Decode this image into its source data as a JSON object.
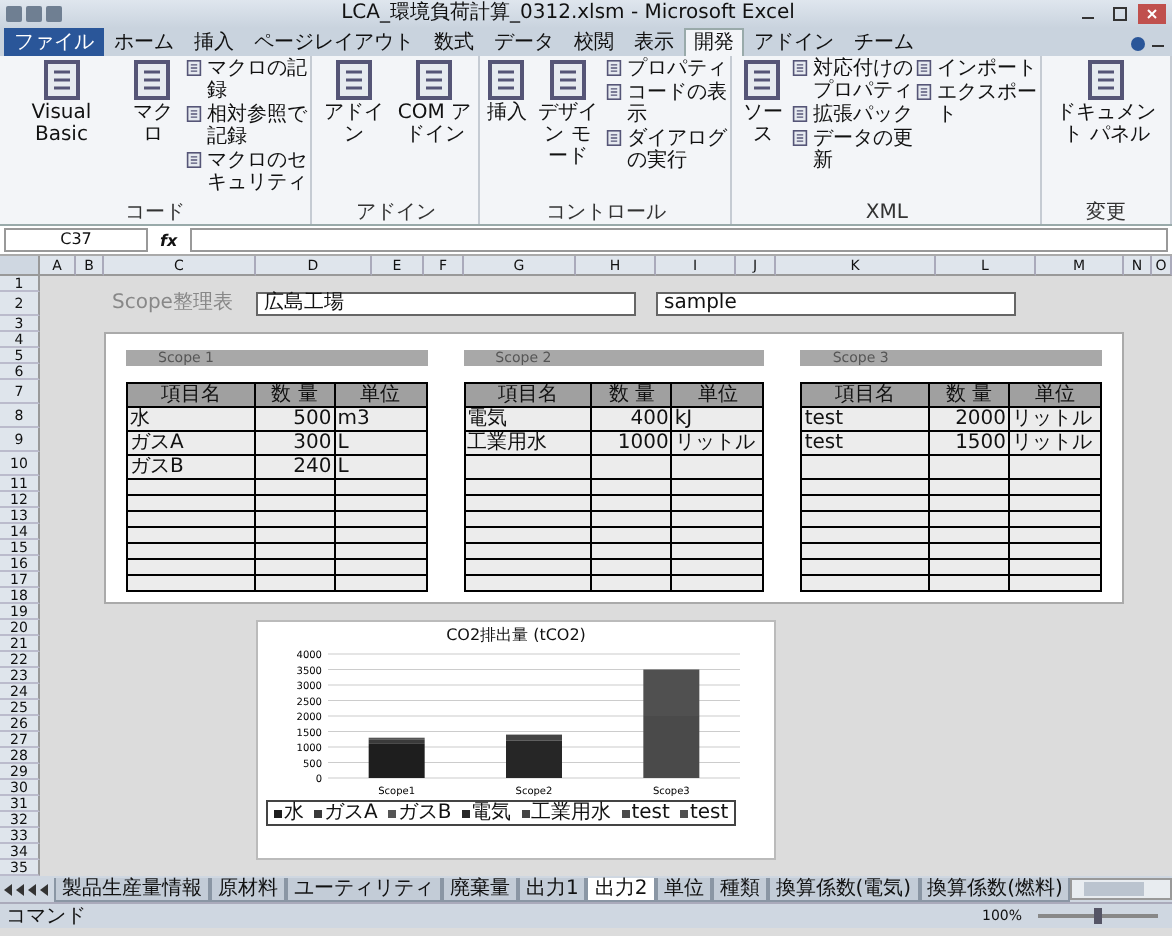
{
  "window": {
    "title": "LCA_環境負荷計算_0312.xlsm - Microsoft Excel"
  },
  "ribbon": {
    "tabs": [
      {
        "label": "ファイル",
        "selected": false
      },
      {
        "label": "ホーム",
        "selected": false
      },
      {
        "label": "挿入",
        "selected": false
      },
      {
        "label": "ページレイアウト",
        "selected": false
      },
      {
        "label": "数式",
        "selected": false
      },
      {
        "label": "データ",
        "selected": false
      },
      {
        "label": "校閲",
        "selected": false
      },
      {
        "label": "表示",
        "selected": false
      },
      {
        "label": "開発",
        "selected": true
      },
      {
        "label": "アドイン",
        "selected": false
      },
      {
        "label": "チーム",
        "selected": false
      }
    ],
    "groups": [
      {
        "label": "コード",
        "items": [
          {
            "kind": "large",
            "label": "Visual Basic"
          },
          {
            "kind": "large",
            "label": "マクロ"
          },
          {
            "kind": "small",
            "label": "マクロの記録"
          },
          {
            "kind": "small",
            "label": "相対参照で記録"
          },
          {
            "kind": "small",
            "label": "マクロのセキュリティ"
          }
        ]
      },
      {
        "label": "アドイン",
        "items": [
          {
            "kind": "large",
            "label": "アドイン"
          },
          {
            "kind": "large",
            "label": "COM アドイン"
          }
        ]
      },
      {
        "label": "コントロール",
        "items": [
          {
            "kind": "large",
            "label": "挿入"
          },
          {
            "kind": "large",
            "label": "デザイン モード"
          },
          {
            "kind": "small",
            "label": "プロパティ"
          },
          {
            "kind": "small",
            "label": "コードの表示"
          },
          {
            "kind": "small",
            "label": "ダイアログの実行"
          }
        ]
      },
      {
        "label": "XML",
        "items": [
          {
            "kind": "large",
            "label": "ソース"
          },
          {
            "kind": "small",
            "label": "対応付けのプロパティ"
          },
          {
            "kind": "small",
            "label": "拡張パック"
          },
          {
            "kind": "small",
            "label": "データの更新"
          },
          {
            "kind": "small",
            "label": "インポート"
          },
          {
            "kind": "small",
            "label": "エクスポート"
          }
        ]
      },
      {
        "label": "変更",
        "items": [
          {
            "kind": "large",
            "label": "ドキュメント パネル"
          }
        ]
      }
    ]
  },
  "formula_bar": {
    "name_box": "C37",
    "fx": "fx"
  },
  "columns": [
    "A",
    "B",
    "C",
    "D",
    "E",
    "F",
    "G",
    "H",
    "I",
    "J",
    "K",
    "L",
    "M",
    "N",
    "O"
  ],
  "rows": [
    "1",
    "2",
    "3",
    "4",
    "5",
    "6",
    "7",
    "8",
    "9",
    "10",
    "11",
    "12",
    "13",
    "14",
    "15",
    "16",
    "17",
    "18",
    "19",
    "20",
    "21",
    "22",
    "23",
    "24",
    "25",
    "26",
    "27",
    "28",
    "29",
    "30",
    "31",
    "32",
    "33",
    "34",
    "35"
  ],
  "sheet_title": "Scope整理表",
  "site_field": "広島工場",
  "sample_field": "sample",
  "scopes": [
    {
      "title": "Scope 1",
      "columns": [
        "項目名",
        "数 量",
        "単位"
      ],
      "rows": [
        [
          "水",
          "500",
          "m3"
        ],
        [
          "ガスA",
          "300",
          "L"
        ],
        [
          "ガスB",
          "240",
          "L"
        ]
      ]
    },
    {
      "title": "Scope 2",
      "columns": [
        "項目名",
        "数 量",
        "単位"
      ],
      "rows": [
        [
          "電気",
          "400",
          "kJ"
        ],
        [
          "工業用水",
          "1000",
          "リットル"
        ]
      ]
    },
    {
      "title": "Scope 3",
      "columns": [
        "項目名",
        "数 量",
        "単位"
      ],
      "rows": [
        [
          "test",
          "2000",
          "リットル"
        ],
        [
          "test",
          "1500",
          "リットル"
        ]
      ]
    }
  ],
  "chart_data": {
    "type": "bar",
    "title": "CO2排出量 (tCO2)",
    "categories": [
      "Scope1",
      "Scope2",
      "Scope3"
    ],
    "stacked": true,
    "grid": true,
    "legend": "bottom",
    "ylim": [
      0,
      4000
    ],
    "yticks": [
      0,
      500,
      1000,
      1500,
      2000,
      2500,
      3000,
      3500,
      4000
    ],
    "series": [
      {
        "name": "水",
        "color": "#1e1e1e",
        "values": [
          1100,
          0,
          0
        ]
      },
      {
        "name": "ガスA",
        "color": "#3a3a3a",
        "values": [
          150,
          0,
          0
        ]
      },
      {
        "name": "ガスB",
        "color": "#555555",
        "values": [
          50,
          0,
          0
        ]
      },
      {
        "name": "電気",
        "color": "#262626",
        "values": [
          0,
          1200,
          0
        ]
      },
      {
        "name": "工業用水",
        "color": "#444444",
        "values": [
          0,
          200,
          0
        ]
      },
      {
        "name": "test",
        "color": "#4a4a4a",
        "values": [
          0,
          0,
          2000
        ]
      },
      {
        "name": "test",
        "color": "#505050",
        "values": [
          0,
          0,
          1500
        ]
      }
    ]
  },
  "sheet_tabs": [
    {
      "label": "製品生産量情報",
      "selected": false
    },
    {
      "label": "原材料",
      "selected": false
    },
    {
      "label": "ユーティリティ",
      "selected": false
    },
    {
      "label": "廃棄量",
      "selected": false
    },
    {
      "label": "出力1",
      "selected": false
    },
    {
      "label": "出力2",
      "selected": true
    },
    {
      "label": "単位",
      "selected": false
    },
    {
      "label": "種類",
      "selected": false
    },
    {
      "label": "換算係数(電気)",
      "selected": false
    },
    {
      "label": "換算係数(燃料)",
      "selected": false
    }
  ],
  "status_bar": {
    "mode": "コマンド",
    "zoom": "100%",
    "zoom_slider": {
      "level": 0.5
    }
  }
}
